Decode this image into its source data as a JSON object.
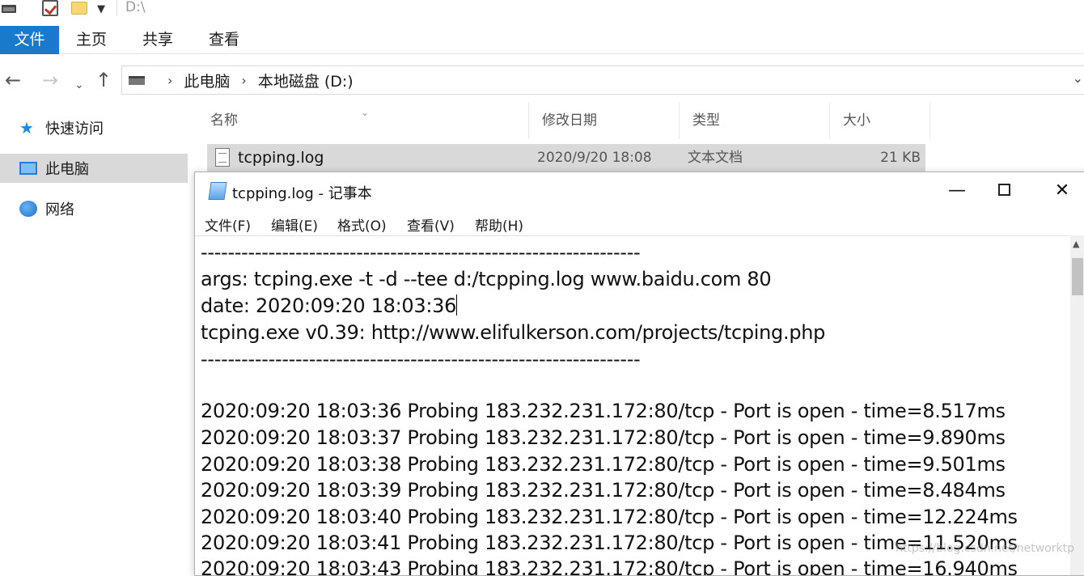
{
  "quick_access": {
    "path": "D:\\"
  },
  "ribbon": {
    "tabs": [
      "文件",
      "主页",
      "共享",
      "查看"
    ]
  },
  "breadcrumb": {
    "items": [
      "此电脑",
      "本地磁盘 (D:)"
    ]
  },
  "sidebar": {
    "items": [
      "快速访问",
      "此电脑",
      "网络"
    ]
  },
  "list": {
    "columns": [
      "名称",
      "修改日期",
      "类型",
      "大小"
    ],
    "file": {
      "name": "tcpping.log",
      "date": "2020/9/20 18:08",
      "type": "文本文档",
      "size": "21 KB"
    }
  },
  "notepad": {
    "title": "tcpping.log - 记事本",
    "menu": [
      "文件(F)",
      "编辑(E)",
      "格式(O)",
      "查看(V)",
      "帮助(H)"
    ],
    "lines": [
      "-----------------------------------------------------------------",
      "args: tcping.exe -t -d --tee d:/tcpping.log www.baidu.com 80",
      "date: 2020:09:20 18:03:36",
      "tcping.exe v0.39: http://www.elifulkerson.com/projects/tcping.php",
      "-----------------------------------------------------------------",
      "",
      "2020:09:20 18:03:36 Probing 183.232.231.172:80/tcp - Port is open - time=8.517ms",
      "2020:09:20 18:03:37 Probing 183.232.231.172:80/tcp - Port is open - time=9.890ms",
      "2020:09:20 18:03:38 Probing 183.232.231.172:80/tcp - Port is open - time=9.501ms",
      "2020:09:20 18:03:39 Probing 183.232.231.172:80/tcp - Port is open - time=8.484ms",
      "2020:09:20 18:03:40 Probing 183.232.231.172:80/tcp - Port is open - time=12.224ms",
      "2020:09:20 18:03:41 Probing 183.232.231.172:80/tcp - Port is open - time=11.520ms",
      "2020:09:20 18:03:43 Probing 183.232.231.172:80/tcp - Port is open - time=16.940ms"
    ]
  },
  "watermark": "https://blog.csdn.net/networktp"
}
